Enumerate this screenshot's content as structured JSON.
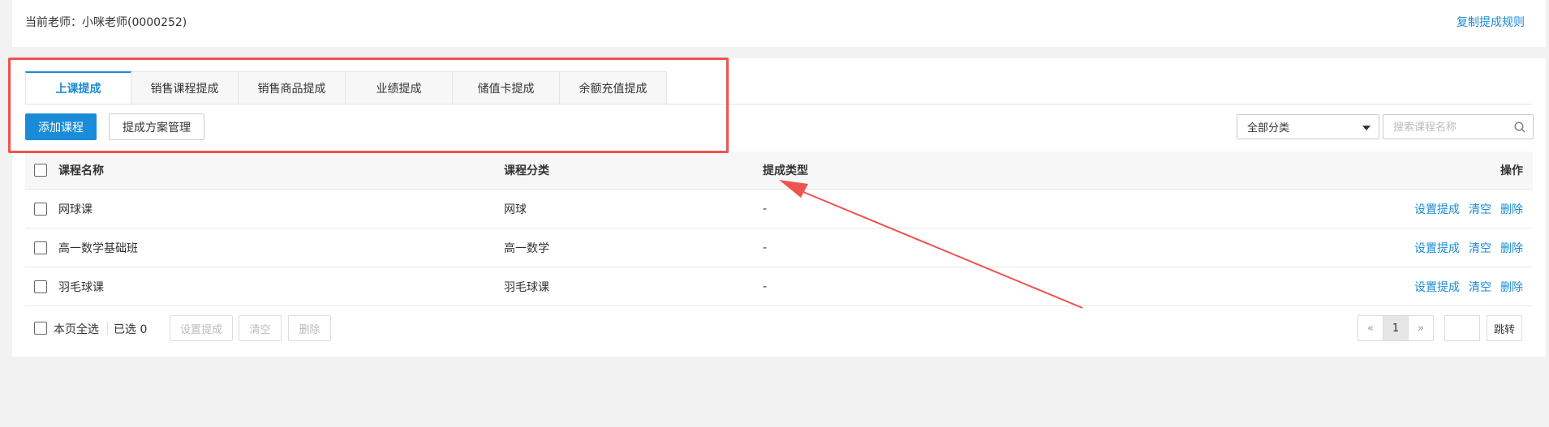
{
  "header": {
    "teacher_label": "当前老师：小咪老师(0000252)",
    "copy_rule_link": "复制提成规则"
  },
  "tabs": [
    {
      "label": "上课提成",
      "active": true
    },
    {
      "label": "销售课程提成",
      "active": false
    },
    {
      "label": "销售商品提成",
      "active": false
    },
    {
      "label": "业绩提成",
      "active": false
    },
    {
      "label": "储值卡提成",
      "active": false
    },
    {
      "label": "余额充值提成",
      "active": false
    }
  ],
  "toolbar": {
    "add_course": "添加课程",
    "plan_manage": "提成方案管理",
    "category_select": "全部分类",
    "search_placeholder": "搜索课程名称"
  },
  "table": {
    "headers": {
      "name": "课程名称",
      "category": "课程分类",
      "type": "提成类型",
      "ops": "操作"
    },
    "rows": [
      {
        "name": "网球课",
        "category": "网球",
        "type": "-"
      },
      {
        "name": "高一数学基础班",
        "category": "高一数学",
        "type": "-"
      },
      {
        "name": "羽毛球课",
        "category": "羽毛球课",
        "type": "-"
      }
    ],
    "row_ops": {
      "set": "设置提成",
      "clear": "清空",
      "delete": "删除"
    }
  },
  "footer": {
    "select_page": "本页全选",
    "selected": "已选 0",
    "set_btn": "设置提成",
    "clear_btn": "清空",
    "delete_btn": "删除"
  },
  "pagination": {
    "prev": "«",
    "current": "1",
    "next": "»",
    "jump": "跳转"
  },
  "colors": {
    "accent": "#1a8bd6",
    "annotation": "#ef5350"
  }
}
